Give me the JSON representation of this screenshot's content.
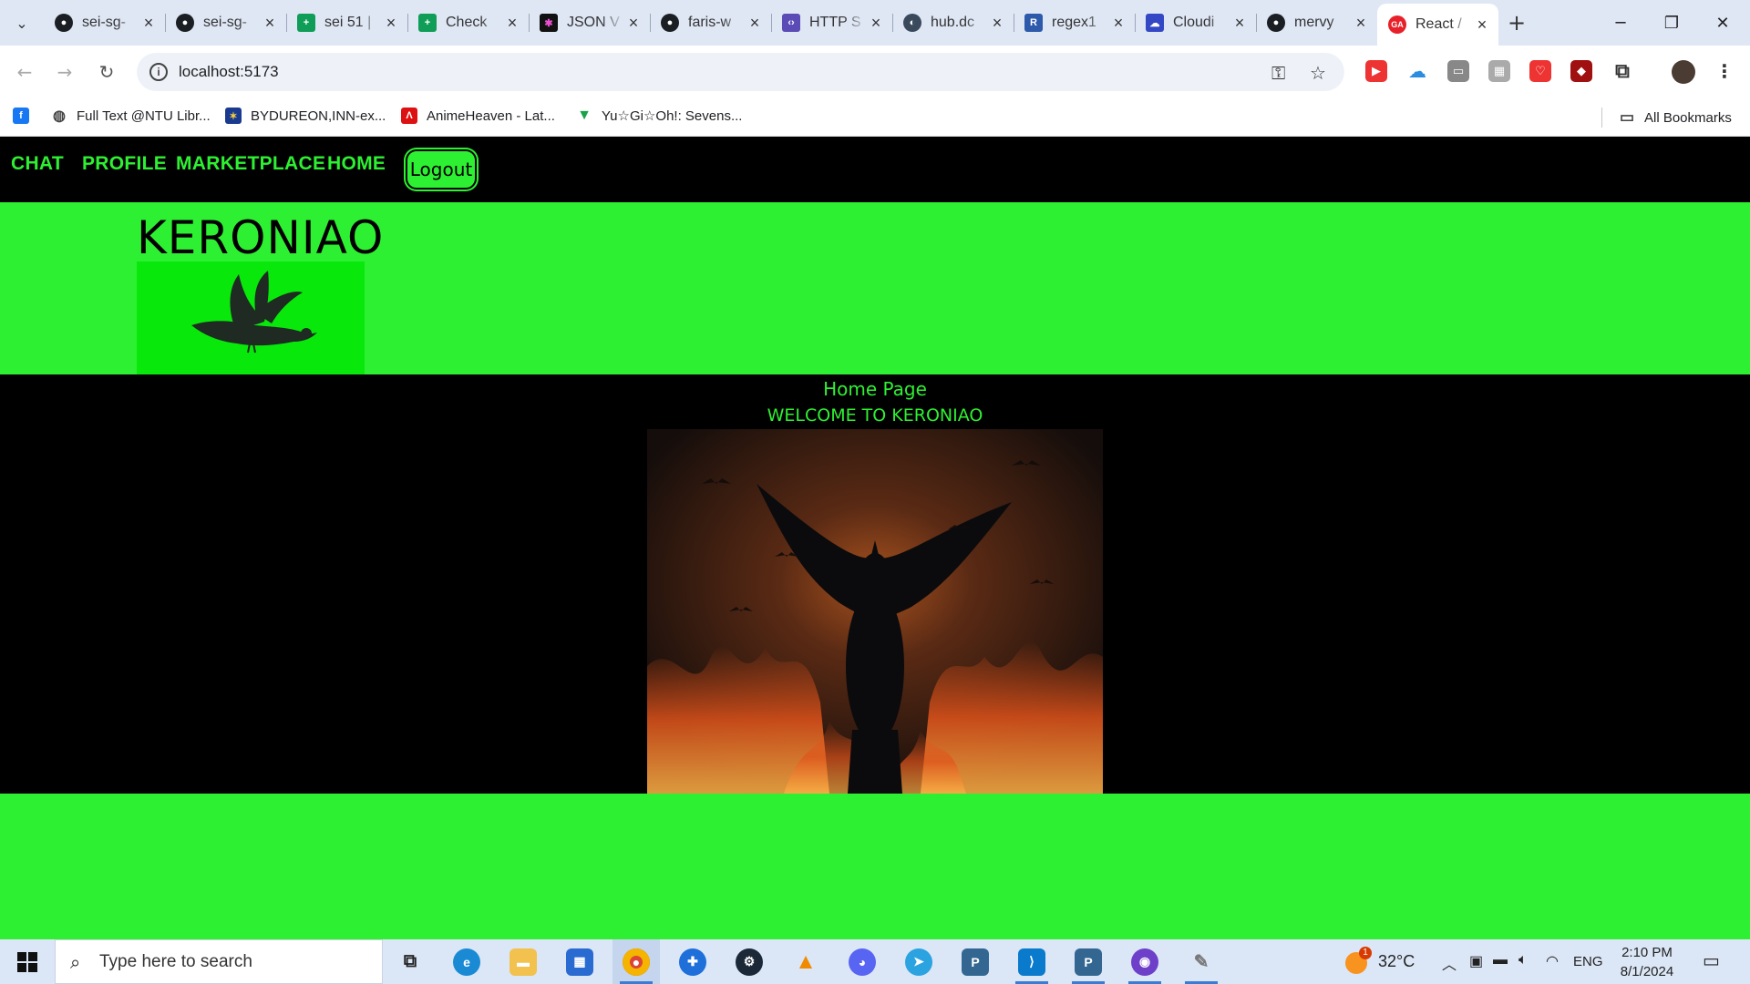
{
  "browser": {
    "tabs": [
      {
        "title": "sei-sg-",
        "icon": "github-icon"
      },
      {
        "title": "sei-sg-",
        "icon": "github-icon"
      },
      {
        "title": "sei 51 |",
        "icon": "google-sheets-icon"
      },
      {
        "title": "Check",
        "icon": "google-sheets-icon"
      },
      {
        "title": "JSON V",
        "icon": "json-icon"
      },
      {
        "title": "faris-w",
        "icon": "github-icon"
      },
      {
        "title": "HTTP S",
        "icon": "http-icon"
      },
      {
        "title": "hub.dc",
        "icon": "docker-hub-icon"
      },
      {
        "title": "regex1",
        "icon": "regex-icon"
      },
      {
        "title": "Cloudi",
        "icon": "cloudinary-icon"
      },
      {
        "title": "mervy",
        "icon": "github-icon"
      },
      {
        "title": "React /",
        "icon": "react-ga-icon",
        "favicon_text": "GA",
        "active": true
      }
    ],
    "url": "localhost:5173",
    "bookmarks": [
      {
        "label": "",
        "icon": "facebook-icon"
      },
      {
        "label": "Full Text @NTU Libr...",
        "icon": "globe-icon"
      },
      {
        "label": "BYDUREON,INN-ex...",
        "icon": "eu-flag-icon"
      },
      {
        "label": "AnimeHeaven - Lat...",
        "icon": "animeheaven-icon"
      },
      {
        "label": "Yu☆Gi☆Oh!: Sevens...",
        "icon": "yugioh-icon"
      }
    ],
    "all_bookmarks_label": "All Bookmarks"
  },
  "app": {
    "nav": {
      "chat": "CHAT",
      "profile": "PROFILE",
      "marketplace": "MARKETPLACE",
      "home": "HOME",
      "logout": "Logout"
    },
    "brand": "KERONIAO",
    "page_heading": "Home Page",
    "welcome": "WELCOME TO KERONIAO",
    "colors": {
      "accent": "#2ef032",
      "logo_bg": "#08e80a",
      "dark": "#000000"
    }
  },
  "taskbar": {
    "search_placeholder": "Type here to search",
    "weather": "32°C",
    "language": "ENG",
    "time": "2:10 PM",
    "date": "8/1/2024",
    "weather_badge": "1"
  }
}
